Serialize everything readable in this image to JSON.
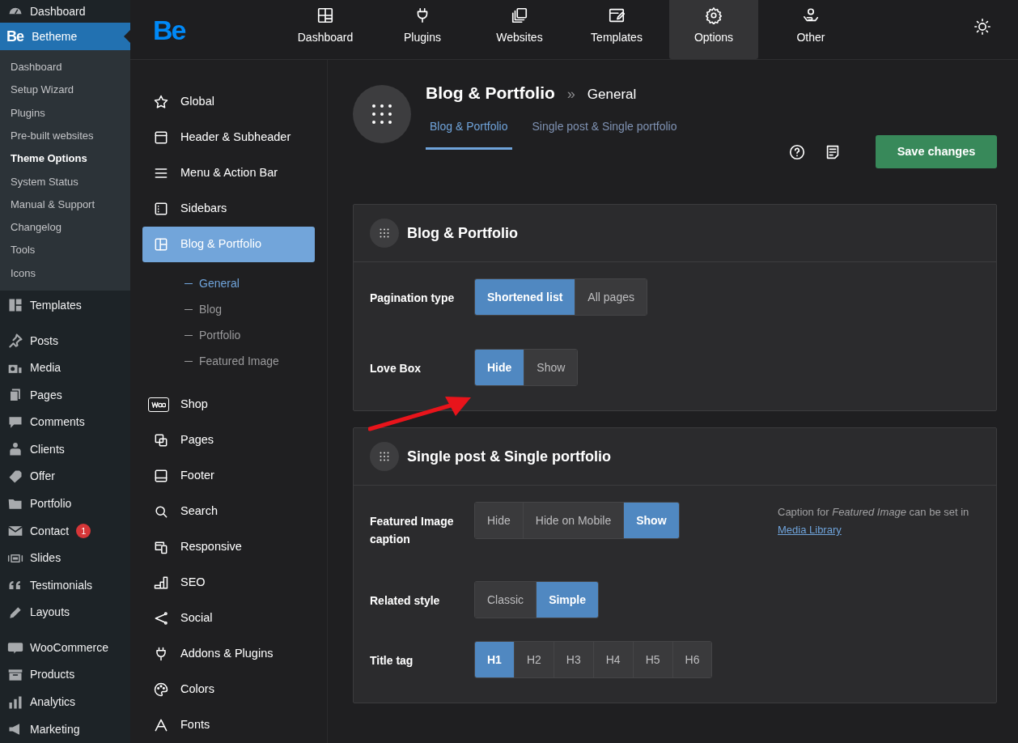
{
  "wp_menu": {
    "top_items": [
      {
        "label": "Dashboard"
      }
    ],
    "active": {
      "logo": "Be",
      "label": "Betheme"
    },
    "submenu": [
      {
        "label": "Dashboard",
        "selected": false
      },
      {
        "label": "Setup Wizard",
        "selected": false
      },
      {
        "label": "Plugins",
        "selected": false
      },
      {
        "label": "Pre-built websites",
        "selected": false
      },
      {
        "label": "Theme Options",
        "selected": true
      },
      {
        "label": "System Status",
        "selected": false
      },
      {
        "label": "Manual & Support",
        "selected": false
      },
      {
        "label": "Changelog",
        "selected": false
      },
      {
        "label": "Tools",
        "selected": false
      },
      {
        "label": "Icons",
        "selected": false
      }
    ],
    "items": [
      {
        "label": "Templates"
      },
      {
        "label": "Posts"
      },
      {
        "label": "Media"
      },
      {
        "label": "Pages"
      },
      {
        "label": "Comments"
      },
      {
        "label": "Clients"
      },
      {
        "label": "Offer"
      },
      {
        "label": "Portfolio"
      },
      {
        "label": "Contact",
        "badge": "1"
      },
      {
        "label": "Slides"
      },
      {
        "label": "Testimonials"
      },
      {
        "label": "Layouts"
      },
      {
        "label": "WooCommerce"
      },
      {
        "label": "Products"
      },
      {
        "label": "Analytics"
      },
      {
        "label": "Marketing"
      }
    ]
  },
  "brand": {
    "logo": "Be"
  },
  "top_nav": [
    {
      "label": "Dashboard",
      "selected": false
    },
    {
      "label": "Plugins",
      "selected": false
    },
    {
      "label": "Websites",
      "selected": false
    },
    {
      "label": "Templates",
      "selected": false
    },
    {
      "label": "Options",
      "selected": true
    },
    {
      "label": "Other",
      "selected": false
    }
  ],
  "options_nav": [
    {
      "label": "Global",
      "selected": false
    },
    {
      "label": "Header & Subheader",
      "selected": false
    },
    {
      "label": "Menu & Action Bar",
      "selected": false
    },
    {
      "label": "Sidebars",
      "selected": false
    },
    {
      "label": "Blog & Portfolio",
      "selected": true,
      "children": [
        {
          "label": "General",
          "selected": true
        },
        {
          "label": "Blog",
          "selected": false
        },
        {
          "label": "Portfolio",
          "selected": false
        },
        {
          "label": "Featured Image",
          "selected": false
        }
      ]
    },
    {
      "label": "Shop",
      "selected": false
    },
    {
      "label": "Pages",
      "selected": false
    },
    {
      "label": "Footer",
      "selected": false
    },
    {
      "label": "Search",
      "selected": false
    },
    {
      "label": "Responsive",
      "selected": false
    },
    {
      "label": "SEO",
      "selected": false
    },
    {
      "label": "Social",
      "selected": false
    },
    {
      "label": "Addons & Plugins",
      "selected": false
    },
    {
      "label": "Colors",
      "selected": false
    },
    {
      "label": "Fonts",
      "selected": false
    }
  ],
  "header": {
    "title": "Blog & Portfolio",
    "separator": "»",
    "crumb": "General",
    "tabs": [
      {
        "label": "Blog & Portfolio",
        "selected": true
      },
      {
        "label": "Single post & Single portfolio",
        "selected": false
      }
    ],
    "save_button": "Save changes"
  },
  "sections": [
    {
      "title": "Blog & Portfolio",
      "rows": [
        {
          "label": "Pagination type",
          "options": [
            {
              "label": "Shortened list",
              "selected": true
            },
            {
              "label": "All pages",
              "selected": false
            }
          ]
        },
        {
          "label": "Love Box",
          "options": [
            {
              "label": "Hide",
              "selected": true
            },
            {
              "label": "Show",
              "selected": false
            }
          ]
        }
      ]
    },
    {
      "title": "Single post & Single portfolio",
      "rows": [
        {
          "label": "Featured Image caption",
          "options": [
            {
              "label": "Hide",
              "selected": false
            },
            {
              "label": "Hide on Mobile",
              "selected": false
            },
            {
              "label": "Show",
              "selected": true
            }
          ],
          "note": "Caption for *Featured Image* can be set in",
          "note_link": "Media Library"
        },
        {
          "label": "Related style",
          "options": [
            {
              "label": "Classic",
              "selected": false
            },
            {
              "label": "Simple",
              "selected": true
            }
          ]
        },
        {
          "label": "Title tag",
          "options": [
            {
              "label": "H1",
              "selected": true
            },
            {
              "label": "H2",
              "selected": false
            },
            {
              "label": "H3",
              "selected": false
            },
            {
              "label": "H4",
              "selected": false
            },
            {
              "label": "H5",
              "selected": false
            },
            {
              "label": "H6",
              "selected": false
            }
          ]
        }
      ]
    }
  ]
}
